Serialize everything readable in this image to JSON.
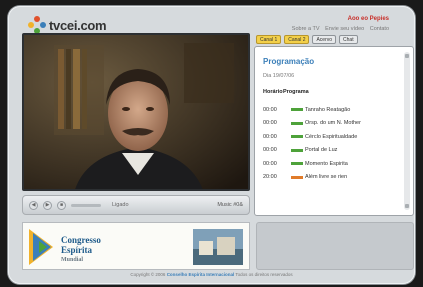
{
  "site": {
    "logo_text": "tvcei.com"
  },
  "topnav": {
    "language": "Aoo eo Pepies",
    "links": [
      "Sobre a TV",
      "Envie seu vídeo",
      "Contato"
    ]
  },
  "tabs": [
    {
      "label": "Canal 1",
      "active": true
    },
    {
      "label": "Canal 2",
      "active": false
    },
    {
      "label": "Acervo",
      "active": false
    },
    {
      "label": "Chat",
      "active": false
    }
  ],
  "programacao": {
    "title": "Programação",
    "date": "Dia 19/07/06",
    "col_horario": "Horário",
    "col_programa": "Programa",
    "rows": [
      {
        "time": "00:00",
        "name": "Tanraho Reatagão",
        "color": "#4ea23a"
      },
      {
        "time": "00:00",
        "name": "Orsp. do um N. Mother",
        "color": "#4ea23a"
      },
      {
        "time": "00:00",
        "name": "Cérclo Espiritualdade",
        "color": "#4ea23a"
      },
      {
        "time": "00:00",
        "name": "Portal de Luz",
        "color": "#4ea23a"
      },
      {
        "time": "00:00",
        "name": "Momento Espirita",
        "color": "#4ea23a"
      },
      {
        "time": "20:00",
        "name": "Além livre se rien",
        "color": "#e07b2a"
      }
    ]
  },
  "player": {
    "status": "Ligado",
    "right_label": "Music #0&"
  },
  "banner": {
    "line1": "Congresso",
    "line2": "Espírita",
    "line3": "Mundial"
  },
  "footer": {
    "prefix": "Copyright © 2006",
    "highlight": "Conselho Espírita Internacional",
    "suffix": "Todos os direitos reservados"
  }
}
